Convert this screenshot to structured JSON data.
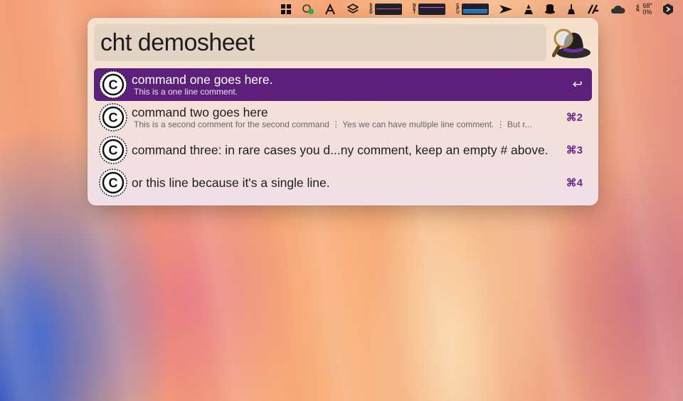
{
  "menubar": {
    "items": [
      {
        "name": "windows-grid-icon",
        "glyph": "▦"
      },
      {
        "name": "app-status-icon",
        "glyph": "❀"
      },
      {
        "name": "script-a-icon",
        "glyph": "A"
      },
      {
        "name": "layers-icon",
        "glyph": "◈"
      }
    ],
    "ssd_label": "SSD",
    "net_label": "NET",
    "cpu_label": "CPU",
    "status_icons": [
      {
        "name": "arrow-icon",
        "glyph": "➤"
      },
      {
        "name": "cone-icon",
        "glyph": "▲"
      },
      {
        "name": "tophat-icon",
        "glyph": "⚱"
      },
      {
        "name": "broom-icon",
        "glyph": "⚲"
      },
      {
        "name": "slash-logo-icon",
        "glyph": "⋈"
      },
      {
        "name": "cloud-icon",
        "glyph": "☁"
      }
    ],
    "temp_labels": {
      "s": "S",
      "n": "N"
    },
    "temp_value": "68°",
    "temp_percent": "0%",
    "end_icon": "⬢"
  },
  "search": {
    "query": "cht demosheet"
  },
  "results": [
    {
      "title": "command one goes here.",
      "subtitle": "This is a one line comment.",
      "shortcut": "↩",
      "selected": true
    },
    {
      "title": "command two goes here",
      "subtitle": "This is a second comment for the second command  ⋮   Yes we can have multiple line comment.  ⋮   But r...",
      "shortcut": "⌘2",
      "selected": false
    },
    {
      "title": "command three: in rare cases you d...ny comment, keep an empty # above.",
      "subtitle": "",
      "shortcut": "⌘3",
      "selected": false
    },
    {
      "title": "or this line because it's a single line.",
      "subtitle": "",
      "shortcut": "⌘4",
      "selected": false
    }
  ],
  "colors": {
    "selected_row": "#5c1f7a",
    "shortcut": "#6c2a8a"
  }
}
